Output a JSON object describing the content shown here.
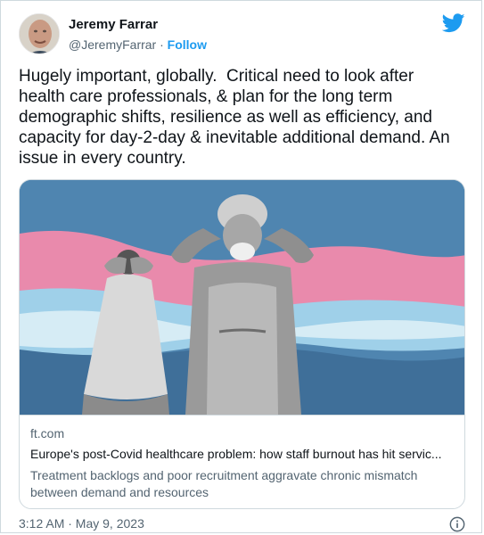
{
  "author": {
    "display_name": "Jeremy Farrar",
    "handle": "@JeremyFarrar",
    "separator": " · ",
    "follow_label": "Follow"
  },
  "tweet": {
    "text": "Hugely important, globally.  Critical need to look after health care professionals, & plan for the long term demographic shifts, resilience as well as efficiency, and capacity for day-2-day & inevitable additional demand. An issue in every country."
  },
  "link_card": {
    "domain": "ft.com",
    "title": "Europe's post-Covid healthcare problem: how staff burnout has hit servic...",
    "description": "Treatment backlogs and poor recruitment aggravate chronic mismatch between demand and resources"
  },
  "footer": {
    "timestamp": "3:12 AM · May 9, 2023"
  },
  "icons": {
    "brand": "twitter-bird-icon",
    "info": "info-icon"
  },
  "colors": {
    "accent": "#1d9bf0",
    "text": "#0f1419",
    "secondary_text": "#536471",
    "border": "#cfd9de"
  }
}
